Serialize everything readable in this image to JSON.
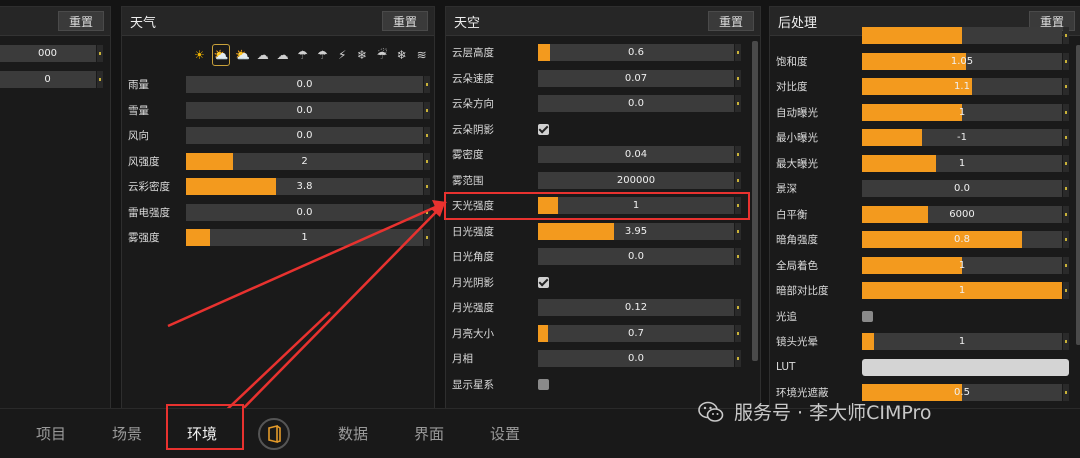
{
  "reset_label": "重置",
  "panel_left": {
    "rows": [
      {
        "value": "000",
        "pct": 0
      },
      {
        "value": "0",
        "pct": 0
      }
    ]
  },
  "panel_weather": {
    "title": "天气",
    "icons": [
      "sun-icon",
      "partly-cloudy-icon",
      "sun-cloud-icon",
      "cloud-icon",
      "cloud-icon",
      "rain-cloud-icon",
      "rain-cloud-icon",
      "thunder-cloud-icon",
      "snow-cloud-icon",
      "storm-cloud-icon",
      "snow-cloud-icon",
      "wind-cloud-icon"
    ],
    "selected_icon": 1,
    "rows": [
      {
        "label": "雨量",
        "value": "0.0",
        "pct": 0
      },
      {
        "label": "雪量",
        "value": "0.0",
        "pct": 0
      },
      {
        "label": "风向",
        "value": "0.0",
        "pct": 0
      },
      {
        "label": "风强度",
        "value": "2",
        "pct": 0.2
      },
      {
        "label": "云彩密度",
        "value": "3.8",
        "pct": 0.38
      },
      {
        "label": "雷电强度",
        "value": "0.0",
        "pct": 0
      },
      {
        "label": "雾强度",
        "value": "1",
        "pct": 0.1
      }
    ]
  },
  "panel_sky": {
    "title": "天空",
    "rows": [
      {
        "label": "云层高度",
        "value": "0.6",
        "pct": 0.06
      },
      {
        "label": "云朵速度",
        "value": "0.07",
        "pct": 0
      },
      {
        "label": "云朵方向",
        "value": "0.0",
        "pct": 0
      },
      {
        "label": "云朵阴影",
        "checkbox": true,
        "checked": true
      },
      {
        "label": "雾密度",
        "value": "0.04",
        "pct": 0
      },
      {
        "label": "雾范围",
        "value": "200000",
        "pct": 0
      },
      {
        "label": "天光强度",
        "value": "1",
        "pct": 0.1
      },
      {
        "label": "日光强度",
        "value": "3.95",
        "pct": 0.39
      },
      {
        "label": "日光角度",
        "value": "0.0",
        "pct": 0
      },
      {
        "label": "月光阴影",
        "checkbox": true,
        "checked": true
      },
      {
        "label": "月光强度",
        "value": "0.12",
        "pct": 0
      },
      {
        "label": "月亮大小",
        "value": "0.7",
        "pct": 0.05
      },
      {
        "label": "月相",
        "value": "0.0",
        "pct": 0
      },
      {
        "label": "显示星系",
        "checkbox": true,
        "checked": false
      }
    ]
  },
  "panel_post": {
    "title": "后处理",
    "rows": [
      {
        "label": "",
        "value": "",
        "pct": 0.5
      },
      {
        "label": "饱和度",
        "value": "1.05",
        "pct": 0.52
      },
      {
        "label": "对比度",
        "value": "1.1",
        "pct": 0.55
      },
      {
        "label": "自动曝光",
        "value": "1",
        "pct": 0.5
      },
      {
        "label": "最小曝光",
        "value": "-1",
        "pct": 0.3
      },
      {
        "label": "最大曝光",
        "value": "1",
        "pct": 0.37
      },
      {
        "label": "景深",
        "value": "0.0",
        "pct": 0
      },
      {
        "label": "白平衡",
        "value": "6000",
        "pct": 0.33
      },
      {
        "label": "暗角强度",
        "value": "0.8",
        "pct": 0.8
      },
      {
        "label": "全局着色",
        "value": "1",
        "pct": 0.5
      },
      {
        "label": "暗部对比度",
        "value": "1",
        "pct": 1
      },
      {
        "label": "光追",
        "checkbox": true,
        "checked": false
      },
      {
        "label": "镜头光晕",
        "value": "1",
        "pct": 0.06
      },
      {
        "label": "LUT",
        "lut": true
      },
      {
        "label": "环境光遮蔽",
        "value": "0.5",
        "pct": 0.5
      }
    ]
  },
  "nav": {
    "items": [
      "项目",
      "场景",
      "环境",
      "数据",
      "界面",
      "设置"
    ],
    "active": 2
  },
  "watermark": "服务号 · 李大师CIMPro",
  "colors": {
    "accent": "#f39a1e",
    "highlight": "#e8322f"
  }
}
